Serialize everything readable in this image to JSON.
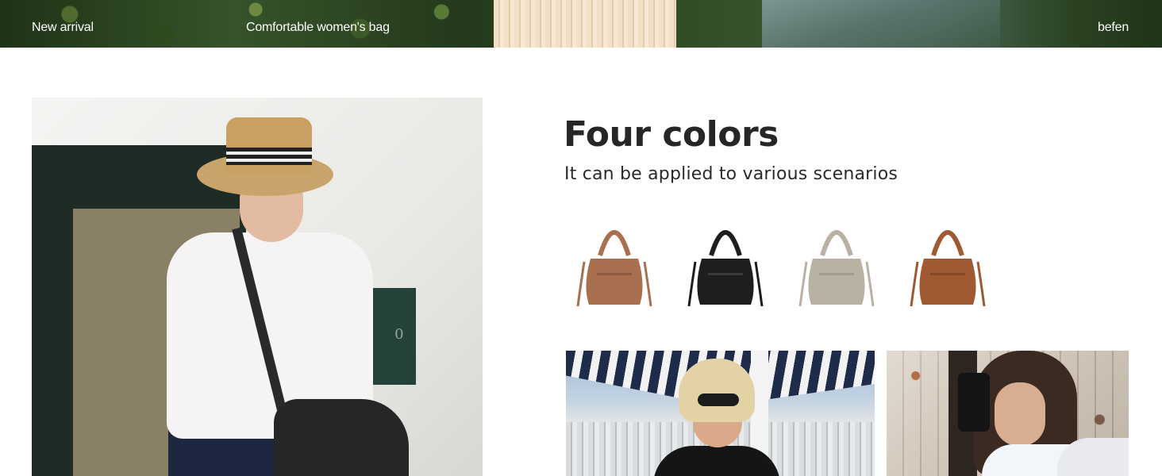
{
  "banner": {
    "left_text": "New arrival",
    "center_text": "Comfortable women's bag",
    "right_text": "befen"
  },
  "hero": {
    "sign_text": "1 0"
  },
  "feature": {
    "title": "Four colors",
    "subtitle": "It can be applied to various scenarios"
  },
  "colors": {
    "brown": "#a9704f",
    "black": "#1e1e1e",
    "gray": "#b9b2a3",
    "caramel": "#9f5a34"
  }
}
